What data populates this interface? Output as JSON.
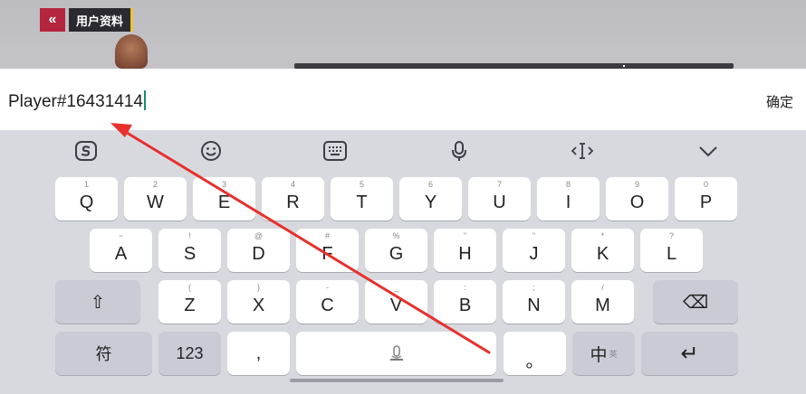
{
  "header": {
    "back_symbol": "«",
    "title": "用户资料"
  },
  "input": {
    "value": "Player#16431414",
    "confirm_label": "确定"
  },
  "toolbar": {
    "icons": [
      "sogou-logo-icon",
      "emoji-icon",
      "keyboard-icon",
      "microphone-icon",
      "cursor-move-icon",
      "collapse-keyboard-icon"
    ]
  },
  "keyboard": {
    "row1": [
      {
        "sub": "1",
        "label": "Q"
      },
      {
        "sub": "2",
        "label": "W"
      },
      {
        "sub": "3",
        "label": "E"
      },
      {
        "sub": "4",
        "label": "R"
      },
      {
        "sub": "5",
        "label": "T"
      },
      {
        "sub": "6",
        "label": "Y"
      },
      {
        "sub": "7",
        "label": "U"
      },
      {
        "sub": "8",
        "label": "I"
      },
      {
        "sub": "9",
        "label": "O"
      },
      {
        "sub": "0",
        "label": "P"
      }
    ],
    "row2": [
      {
        "sub": "~",
        "label": "A"
      },
      {
        "sub": "!",
        "label": "S"
      },
      {
        "sub": "@",
        "label": "D"
      },
      {
        "sub": "#",
        "label": "F"
      },
      {
        "sub": "%",
        "label": "G"
      },
      {
        "sub": "\"",
        "label": "H"
      },
      {
        "sub": "\"",
        "label": "J"
      },
      {
        "sub": "*",
        "label": "K"
      },
      {
        "sub": "?",
        "label": "L"
      }
    ],
    "row3": [
      {
        "sub": "(",
        "label": "Z"
      },
      {
        "sub": ")",
        "label": "X"
      },
      {
        "sub": "-",
        "label": "C"
      },
      {
        "sub": "_",
        "label": "V"
      },
      {
        "sub": ":",
        "label": "B"
      },
      {
        "sub": ";",
        "label": "N"
      },
      {
        "sub": "/",
        "label": "M"
      }
    ],
    "row4": {
      "symbols_label": "符",
      "numbers_label": "123",
      "comma_label": ",",
      "period_label": "。",
      "lang_label": "中",
      "lang_sub": "英",
      "enter_symbol": "↵",
      "shift_symbol": "⇧",
      "backspace_symbol": "⌫"
    }
  },
  "colors": {
    "back_red": "#b3263e",
    "caret": "#1a8a74",
    "arrow_red": "#e8302c"
  }
}
